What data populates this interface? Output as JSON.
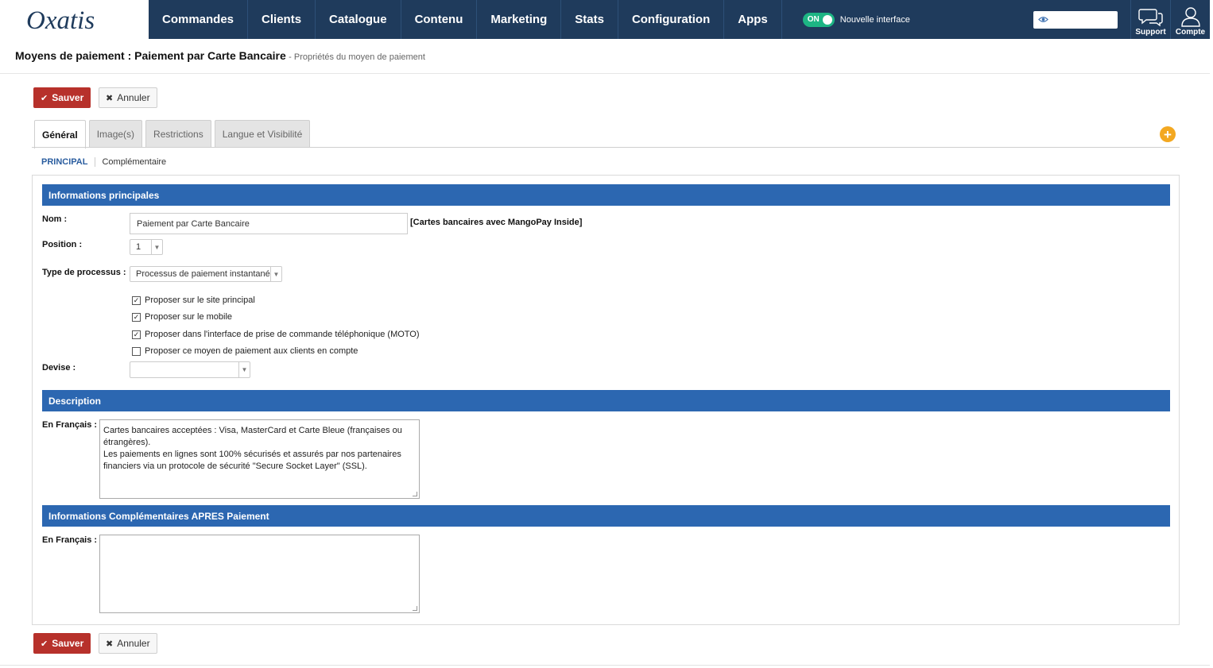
{
  "brand": {
    "logo_text": "Oxatis"
  },
  "nav": {
    "items": [
      {
        "label": "Commandes"
      },
      {
        "label": "Clients"
      },
      {
        "label": "Catalogue"
      },
      {
        "label": "Contenu"
      },
      {
        "label": "Marketing"
      },
      {
        "label": "Stats"
      },
      {
        "label": "Configuration"
      },
      {
        "label": "Apps"
      }
    ],
    "toggle_state": "ON",
    "toggle_label": "Nouvelle interface",
    "support_label": "Support",
    "account_label": "Compte"
  },
  "header": {
    "title": "Moyens de paiement : Paiement par Carte Bancaire",
    "subtitle": "- Propriétés du moyen de paiement"
  },
  "actions": {
    "save_label": "Sauver",
    "cancel_label": "Annuler"
  },
  "tabs": [
    {
      "label": "Général",
      "active": true
    },
    {
      "label": "Image(s)"
    },
    {
      "label": "Restrictions"
    },
    {
      "label": "Langue et Visibilité"
    }
  ],
  "subtabs": {
    "principal": "PRINCIPAL",
    "complementaire": "Complémentaire"
  },
  "main_info": {
    "section_title": "Informations principales",
    "name_label": "Nom :",
    "name_value": "Paiement par Carte Bancaire",
    "name_note": "[Cartes bancaires avec MangoPay Inside]",
    "position_label": "Position :",
    "position_value": "1",
    "process_label": "Type de processus :",
    "process_value": "Processus de paiement instantané",
    "checkboxes": [
      {
        "label": "Proposer sur le site principal",
        "checked": true
      },
      {
        "label": "Proposer sur le mobile",
        "checked": true
      },
      {
        "label": "Proposer dans l'interface de prise de commande téléphonique (MOTO)",
        "checked": true
      },
      {
        "label": "Proposer ce moyen de paiement aux clients en compte",
        "checked": false
      }
    ],
    "currency_label": "Devise :",
    "currency_value": ""
  },
  "description": {
    "section_title": "Description",
    "fr_label": "En Français :",
    "fr_lines": [
      "Cartes bancaires acceptées : Visa, MasterCard et Carte Bleue (françaises ou",
      "étrangères).",
      "Les paiements en lignes sont 100% sécurisés et assurés par nos partenaires",
      "financiers via un protocole de sécurité  \"Secure Socket Layer\" (SSL)."
    ]
  },
  "after_payment": {
    "section_title": "Informations Complémentaires APRES Paiement",
    "fr_label": "En Français :",
    "fr_value": ""
  },
  "colors": {
    "topbar": "#1f3b5c",
    "section": "#2c67b1",
    "save": "#b7312b",
    "toggle": "#1db584",
    "plus": "#f3a821"
  },
  "icons": {
    "eye": "eye-icon",
    "support": "chat-bubbles-icon",
    "account": "user-icon",
    "plus": "plus-circle-icon",
    "check": "checkmark-icon",
    "close": "close-icon"
  }
}
